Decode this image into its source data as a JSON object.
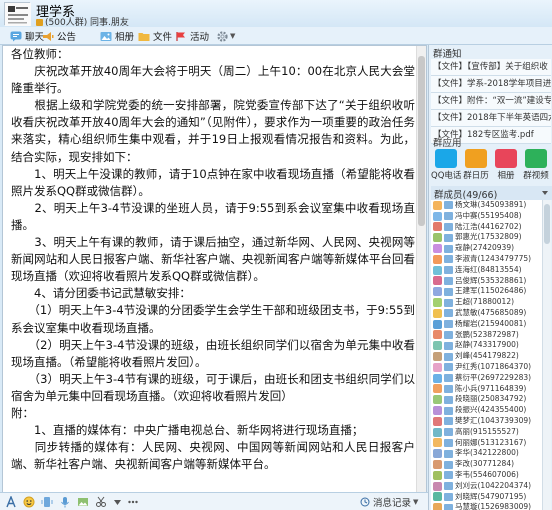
{
  "window": {
    "title": "理学系",
    "subtitle": "(500人群) 同事.朋友"
  },
  "toolbar": [
    {
      "key": "chat",
      "label": "聊天",
      "icon": "chat-icon"
    },
    {
      "key": "announcement",
      "label": "公告",
      "icon": "announcement-icon"
    },
    {
      "key": "album",
      "label": "相册",
      "icon": "album-icon"
    },
    {
      "key": "file",
      "label": "文件",
      "icon": "file-icon"
    },
    {
      "key": "activity",
      "label": "活动",
      "icon": "activity-icon"
    }
  ],
  "message": {
    "paragraphs": [
      "各位教师：",
      "　　庆祝改革开放40周年大会将于明天（周二）上午10：00在北京人民大会堂隆重举行。",
      "　　根据上级和学院党委的统一安排部署，院党委宣传部下达了“关于组织收听收看庆祝改革开放40周年大会的通知”（见附件），要求作为一项重要的政治任务来落实，精心组织师生集中观看，并于19日上报观看情况报告和资料。为此，结合实际，现安排如下：",
      "　　1、明天上午没课的教师，请于10点钟在家中收看现场直播（希望能将收看照片发系QQ群或微信群）。",
      "　　2、明天上午3-4节没课的坐班人员，请于9:55到系会议室集中收看现场直播。",
      "　　3、明天上午有课的教师，请于课后抽空，通过新华网、人民网、央视网等新闻网站和人民日报客户端、新华社客户端、央视新闻客户端等新媒体平台回看现场直播（欢迎将收看照片发系QQ群或微信群）。",
      "　　4、请分团委书记武慧敏安排：",
      "　　（1）明天上午3-4节没课的分团委学生会学生干部和班级团支书，于9:55到系会议室集中收看现场直播。",
      "　　（2）明天上午3-4节没课的班级，由班长组织同学们以宿舍为单元集中收看现场直播。（希望能将收看照片发回）。",
      "　　（3）明天上午3-4节有课的班级，可于课后，由班长和团支书组织同学们以宿舍为单元集中回看现场直播。（欢迎将收看照片发回）",
      "附：",
      "　　1、直播的媒体有：中央广播电视总台、新华网将进行现场直播；",
      "　　同步转播的媒体有：人民网、央视网、中国网等新闻网站和人民日报客户端、新华社客户端、央视新闻客户端等新媒体平台。"
    ]
  },
  "input_bar": {
    "right_label": "消息记录",
    "icons": [
      "font-icon",
      "emoji-icon",
      "shake-icon",
      "screenshot-icon",
      "scissors-icon",
      "more-icon"
    ]
  },
  "sidebar": {
    "announcements_title": "群通知",
    "announcements": [
      "【文件】【宣传部】关于组织收",
      "【文件】学系-2018学年项目进",
      "【文件】附件：“双一流”建设专题",
      "【文件】2018年下半年英语四六级",
      "【文件】182专区监考.pdf"
    ],
    "apps_title": "群应用",
    "apps": [
      {
        "label": "QQ电话",
        "color": "#1aa7e8",
        "icon": "qq-call-icon"
      },
      {
        "label": "群日历",
        "color": "#f0a020",
        "icon": "calendar-icon"
      },
      {
        "label": "相册",
        "color": "#e8455a",
        "icon": "photo-icon"
      },
      {
        "label": "群视频",
        "color": "#2db15a",
        "icon": "video-icon"
      }
    ],
    "members_title": "群成员(49/66)",
    "members": [
      {
        "name": "杨文琳(345093891)",
        "color": "#f4b45c"
      },
      {
        "name": "冯中赛(55195408)",
        "color": "#7db7e8"
      },
      {
        "name": "陆江浩(44162702)",
        "color": "#e27a6c"
      },
      {
        "name": "郭惠光(17532809)",
        "color": "#9ac36a"
      },
      {
        "name": "寇静(27420939)",
        "color": "#c98ee0"
      },
      {
        "name": "李淑青(1243479775)",
        "color": "#f29a5a"
      },
      {
        "name": "连海红(84813554)",
        "color": "#6fbfd8"
      },
      {
        "name": "吕俊辉(535328861)",
        "color": "#d86a8e"
      },
      {
        "name": "王建军(115026486)",
        "color": "#8fa8e0"
      },
      {
        "name": "王超(71880012)",
        "color": "#a3d070"
      },
      {
        "name": "武慧敏(475685089)",
        "color": "#f0c050"
      },
      {
        "name": "杨耀岩(215940081)",
        "color": "#5aa0d8"
      },
      {
        "name": "张鹏(523872987)",
        "color": "#e88a6a"
      },
      {
        "name": "赵静(743317900)",
        "color": "#7cc4b0"
      },
      {
        "name": "刘峰(454179822)",
        "color": "#c4a07a"
      },
      {
        "name": "尹红秀(1071864370)",
        "color": "#e6a2c8"
      },
      {
        "name": "蔡衍平(2697229283)",
        "color": "#6ab0e6"
      },
      {
        "name": "陈小兵(971164839)",
        "color": "#f0a060"
      },
      {
        "name": "段晓丽(250834792)",
        "color": "#98c878"
      },
      {
        "name": "段振兴(424355400)",
        "color": "#b890d8"
      },
      {
        "name": "樊梦汇(1043739309)",
        "color": "#e07878"
      },
      {
        "name": "高丽(915155527)",
        "color": "#70b8c8"
      },
      {
        "name": "何丽娜(513123167)",
        "color": "#f2b860"
      },
      {
        "name": "李华(342122800)",
        "color": "#88a8d8"
      },
      {
        "name": "李改(30771284)",
        "color": "#d89a70"
      },
      {
        "name": "李韦(554607006)",
        "color": "#a0c060"
      },
      {
        "name": "刘刈云(1042204374)",
        "color": "#c888b0"
      },
      {
        "name": "刘晓辉(547907195)",
        "color": "#5ab8a0"
      },
      {
        "name": "马慧璇(1526983009)",
        "color": "#e8a858"
      }
    ]
  }
}
